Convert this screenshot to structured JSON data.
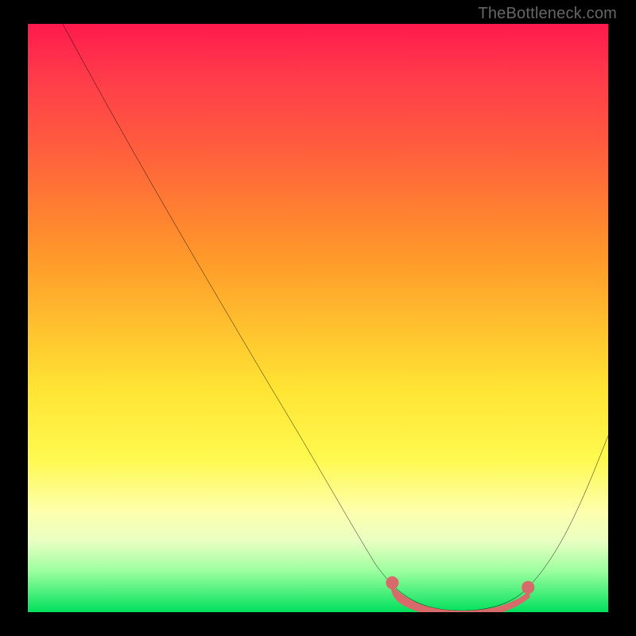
{
  "attribution": "TheBottleneck.com",
  "colors": {
    "frame": "#000000",
    "gradient_top": "#ff1a4d",
    "gradient_bottom": "#00e05c",
    "curve": "#000000",
    "marker": "#d96a6a"
  },
  "chart_data": {
    "type": "line",
    "title": "",
    "xlabel": "",
    "ylabel": "",
    "xlim": [
      0,
      100
    ],
    "ylim": [
      100,
      0
    ],
    "grid": false,
    "legend": false,
    "series": [
      {
        "name": "bottleneck-curve",
        "x": [
          6,
          10,
          15,
          20,
          25,
          30,
          35,
          40,
          45,
          50,
          55,
          58,
          60,
          63,
          67,
          72,
          77,
          82,
          86,
          90,
          94,
          98,
          100
        ],
        "y": [
          0,
          7,
          15,
          23,
          31,
          39,
          47,
          55,
          63,
          71,
          79,
          84,
          89,
          94,
          98,
          100,
          100,
          100,
          97,
          92,
          85,
          76,
          70
        ]
      }
    ],
    "markers": {
      "name": "highlighted-flat-region",
      "x": [
        63,
        65,
        68,
        71,
        74,
        77,
        80,
        83,
        85
      ],
      "y": [
        96,
        97.5,
        98.5,
        99.2,
        99.5,
        99.5,
        99.2,
        98.3,
        96.5
      ]
    }
  }
}
